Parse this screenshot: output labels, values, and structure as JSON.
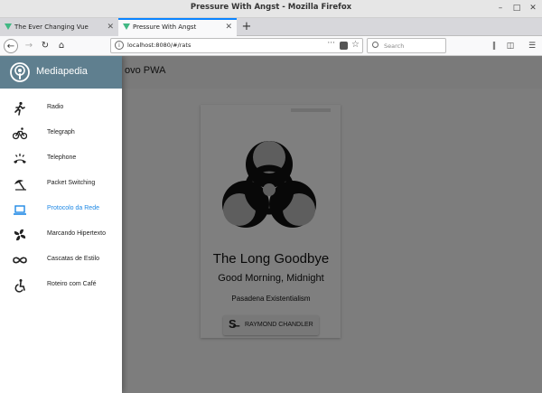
{
  "window": {
    "title": "Pressure With Angst - Mozilla Firefox"
  },
  "tabs": [
    {
      "label": "The Ever Changing Vue",
      "active": false
    },
    {
      "label": "Pressure With Angst",
      "active": true
    }
  ],
  "navbar": {
    "url": "localhost:8080/#/rats",
    "search_placeholder": "Search"
  },
  "app": {
    "title": "ovo PWA",
    "brand": "Mediapedia",
    "brand_color": "#5f7f8f",
    "accent_color": "#1e88e5"
  },
  "drawer": {
    "items": [
      {
        "label": "Radio",
        "icon": "run-icon",
        "active": false
      },
      {
        "label": "Telegraph",
        "icon": "bike-icon",
        "active": false
      },
      {
        "label": "Telephone",
        "icon": "ringing-phone-icon",
        "active": false
      },
      {
        "label": "Packet Switching",
        "icon": "umbrella-icon",
        "active": false
      },
      {
        "label": "Protocolo da Rede",
        "icon": "laptop-icon",
        "active": true
      },
      {
        "label": "Marcando Hipertexto",
        "icon": "fan-icon",
        "active": false
      },
      {
        "label": "Cascatas de Estilo",
        "icon": "infinity-icon",
        "active": false
      },
      {
        "label": "Roteiro com Café",
        "icon": "accessible-icon",
        "active": false
      }
    ]
  },
  "card": {
    "image_icon": "biohazard-icon",
    "title": "The Long Goodbye",
    "subtitle": "Good Morning, Midnight",
    "caption": "Pasadena Existentialism",
    "author_button": "RAYMOND CHANDLER",
    "author_icon": "strikethrough-s-icon"
  }
}
